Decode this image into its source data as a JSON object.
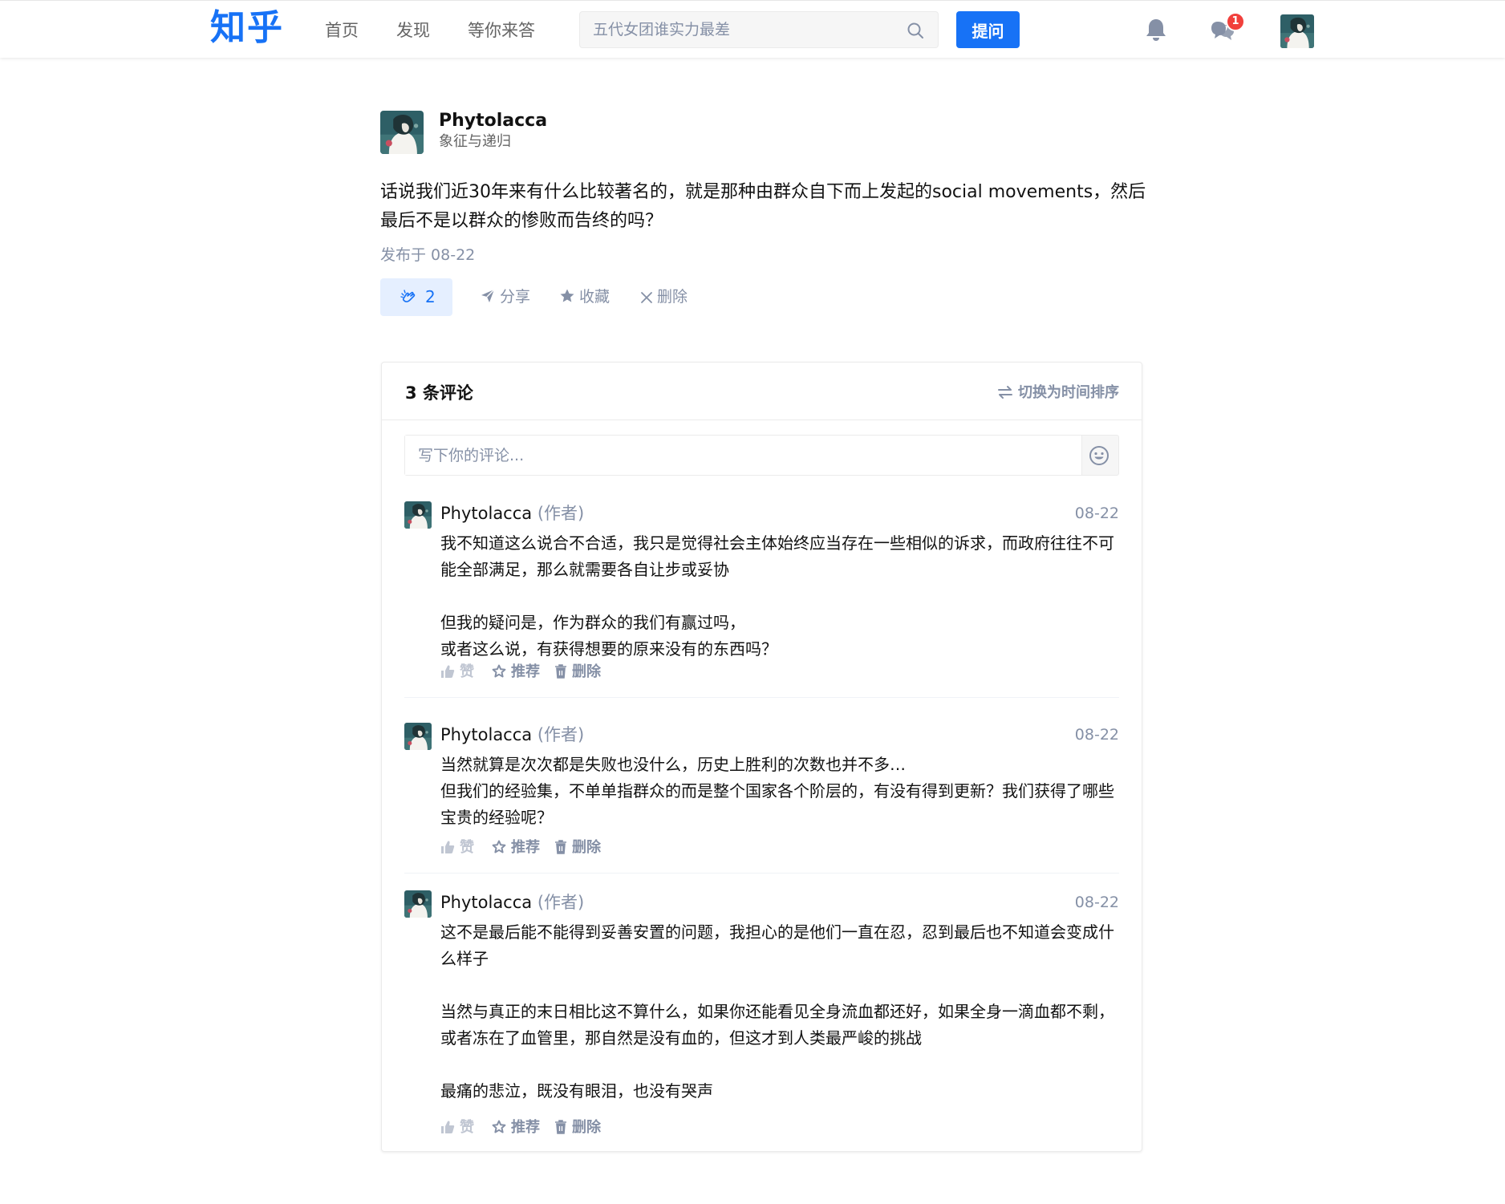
{
  "header": {
    "logo": "知乎",
    "nav": [
      "首页",
      "发现",
      "等你来答"
    ],
    "search_placeholder": "五代女团谁实力最差",
    "ask_label": "提问",
    "message_badge": "1"
  },
  "post": {
    "author": "Phytolacca",
    "subtitle": "象征与递归",
    "text": "话说我们近30年来有什么比较著名的，就是那种由群众自下而上发起的social movements，然后最后不是以群众的惨败而告终的吗？",
    "date": "发布于 08-22",
    "like_count": "2",
    "actions": {
      "share": "分享",
      "collect": "收藏",
      "delete": "删除"
    }
  },
  "comments": {
    "title": "3 条评论",
    "sort_label": "切换为时间排序",
    "input_placeholder": "写下你的评论...",
    "action_labels": {
      "like": "赞",
      "recommend": "推荐",
      "delete": "删除"
    },
    "items": [
      {
        "author": "Phytolacca",
        "role": "(作者)",
        "date": "08-22",
        "lines": [
          "我不知道这么说合不合适，我只是觉得社会主体始终应当存在一些相似的诉求，而政府往往不可能全部满足，那么就需要各自让步或妥协",
          "",
          "但我的疑问是，作为群众的我们有赢过吗，",
          "或者这么说，有获得想要的原来没有的东西吗？"
        ]
      },
      {
        "author": "Phytolacca",
        "role": "(作者)",
        "date": "08-22",
        "lines": [
          "当然就算是次次都是失败也没什么，历史上胜利的次数也并不多…",
          "但我们的经验集，不单单指群众的而是整个国家各个阶层的，有没有得到更新？我们获得了哪些宝贵的经验呢？"
        ]
      },
      {
        "author": "Phytolacca",
        "role": "(作者)",
        "date": "08-22",
        "lines": [
          "这不是最后能不能得到妥善安置的问题，我担心的是他们一直在忍，忍到最后也不知道会变成什么样子",
          "",
          "当然与真正的末日相比这不算什么，如果你还能看见全身流血都还好，如果全身一滴血都不剩，或者冻在了血管里，那自然是没有血的，但这才到人类最严峻的挑战",
          "",
          "最痛的悲泣，既没有眼泪，也没有哭声"
        ]
      }
    ]
  }
}
